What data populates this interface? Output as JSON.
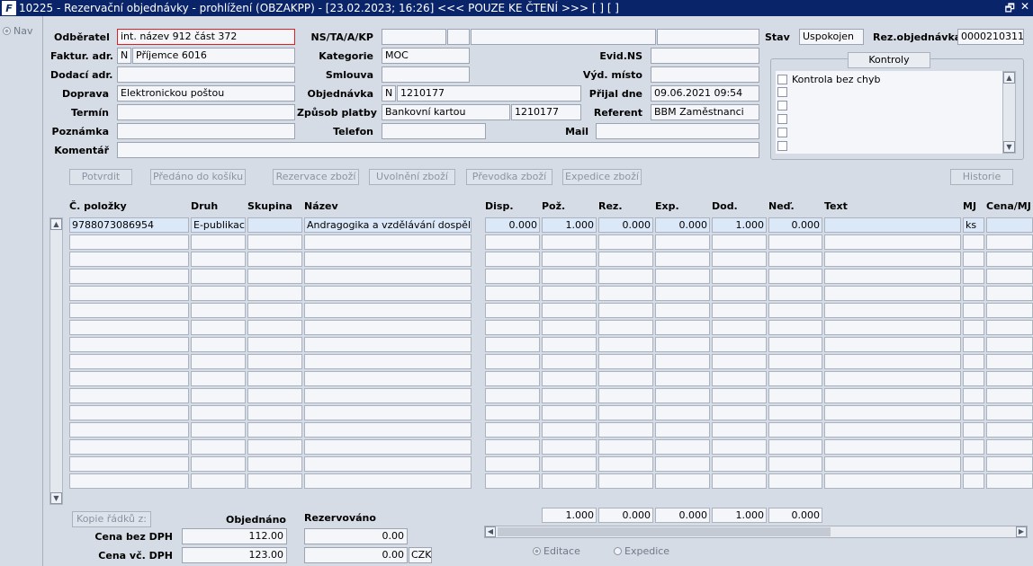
{
  "window": {
    "title": "10225 - Rezervační objednávky - prohlížení (OBZAKPP) - [23.02.2023; 16:26] <<< POUZE KE ČTENÍ >>> [ ] [ ]",
    "icon": "F",
    "buttons": [
      "🗗",
      "✕"
    ]
  },
  "nav": {
    "label": "Nav"
  },
  "form": {
    "odberatel": {
      "label": "Odběratel",
      "value": "int. název 912 část 372"
    },
    "faktur": {
      "label": "Faktur. adr.",
      "flag": "N",
      "value": "Příjemce 6016"
    },
    "dodaci": {
      "label": "Dodací adr.",
      "value": ""
    },
    "doprava": {
      "label": "Doprava",
      "value": "Elektronickou poštou"
    },
    "termin": {
      "label": "Termín",
      "value": ""
    },
    "poznamka": {
      "label": "Poznámka",
      "value": ""
    },
    "komentar": {
      "label": "Komentář",
      "value": ""
    },
    "nsta": {
      "label": "NS/TA/A/KP"
    },
    "kategorie": {
      "label": "Kategorie",
      "value": "MOC"
    },
    "smlouva": {
      "label": "Smlouva",
      "value": ""
    },
    "objednavka": {
      "label": "Objednávka",
      "flag": "N",
      "value": "1210177"
    },
    "zpusob": {
      "label": "Způsob platby",
      "value": "Bankovní kartou",
      "value2": "1210177"
    },
    "telefon": {
      "label": "Telefon",
      "value": ""
    },
    "evidns": {
      "label": "Evid.NS",
      "value": ""
    },
    "vydmisto": {
      "label": "Výd. místo",
      "value": ""
    },
    "prijal": {
      "label": "Přijal dne",
      "value": "09.06.2021 09:54"
    },
    "referent": {
      "label": "Referent",
      "value": "BBM Zaměstnanci"
    },
    "mail": {
      "label": "Mail",
      "value": ""
    },
    "stav": {
      "label": "Stav",
      "value": "Uspokojen"
    },
    "rezobj": {
      "label": "Rez.objednávka",
      "value": "0000210311"
    }
  },
  "kontroly": {
    "button": "Kontroly",
    "items": [
      "Kontrola bez chyb"
    ]
  },
  "actions": {
    "potvrdit": "Potvrdit",
    "predano": "Předáno do košíku",
    "rezervace": "Rezervace zboží",
    "uvolneni": "Uvolnění zboží",
    "prevodka": "Převodka zboží",
    "expedice": "Expedice zboží",
    "historie": "Historie"
  },
  "table": {
    "headers": {
      "polozka": "Č. položky",
      "druh": "Druh",
      "skupina": "Skupina",
      "nazev": "Název",
      "disp": "Disp.",
      "poz": "Pož.",
      "rez": "Rez.",
      "exp": "Exp.",
      "dod": "Dod.",
      "ned": "Neď.",
      "text": "Text",
      "mj": "MJ",
      "cena": "Cena/MJ"
    },
    "row1": {
      "polozka": "9788073086954",
      "druh": "E-publikace",
      "skupina": "",
      "nazev": "Andragogika a vzdělávání dospělých.",
      "disp": "0.000",
      "poz": "1.000",
      "rez": "0.000",
      "exp": "0.000",
      "dod": "1.000",
      "ned": "0.000",
      "text": "",
      "mj": "ks",
      "cena": ""
    },
    "totals": {
      "poz": "1.000",
      "rez": "0.000",
      "exp": "0.000",
      "dod": "1.000",
      "ned": "0.000"
    }
  },
  "summary": {
    "kopie": "Kopie řádků z:",
    "objednano": "Objednáno",
    "rezervovano": "Rezervováno",
    "cena_bez": {
      "label": "Cena bez DPH",
      "obj": "112.00",
      "rez": "0.00"
    },
    "cena_vc": {
      "label": "Cena vč. DPH",
      "obj": "123.00",
      "rez": "0.00",
      "mena": "CZK"
    }
  },
  "modes": {
    "editace": "Editace",
    "expedice": "Expedice"
  }
}
